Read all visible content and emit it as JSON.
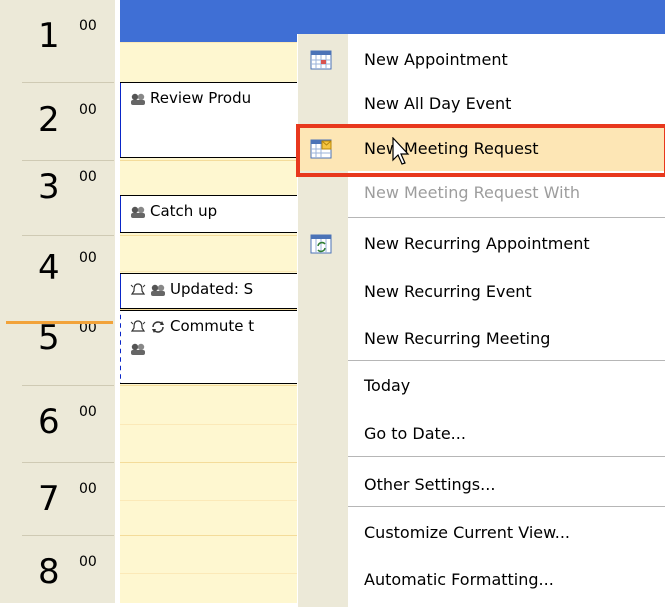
{
  "time_ruler": {
    "hours": [
      {
        "h": "1",
        "m": "00"
      },
      {
        "h": "2",
        "m": "00"
      },
      {
        "h": "3",
        "m": "00"
      },
      {
        "h": "4",
        "m": "00"
      },
      {
        "h": "5",
        "m": "00"
      },
      {
        "h": "6",
        "m": "00"
      },
      {
        "h": "7",
        "m": "00"
      },
      {
        "h": "8",
        "m": "00"
      }
    ],
    "current_hour": "5"
  },
  "appointments": [
    {
      "title": "Review Produ",
      "icons": "recurring-meeting-icon"
    },
    {
      "title": "Catch up",
      "icons": "meeting-icon"
    },
    {
      "title": "Updated: S",
      "icons": "reminder-meeting-icon"
    },
    {
      "title": "Commute t",
      "icons": "reminder-recurring-icon"
    }
  ],
  "context_menu": {
    "items": [
      {
        "label": "New Appointment",
        "icon": "calendar-grid-icon"
      },
      {
        "label": "New All Day Event",
        "icon": ""
      },
      {
        "label": "New Meeting Request",
        "icon": "meeting-request-icon",
        "highlighted": true
      },
      {
        "label": "New Meeting Request With",
        "icon": "",
        "disabled": true
      },
      {
        "label": "New Recurring Appointment",
        "icon": "recurring-calendar-icon"
      },
      {
        "label": "New Recurring Event",
        "icon": ""
      },
      {
        "label": "New Recurring Meeting",
        "icon": ""
      },
      {
        "label": "Today",
        "icon": ""
      },
      {
        "label": "Go to Date...",
        "icon": ""
      },
      {
        "label": "Other Settings...",
        "icon": ""
      },
      {
        "label": "Customize Current View...",
        "icon": ""
      },
      {
        "label": "Automatic Formatting...",
        "icon": ""
      }
    ]
  },
  "colors": {
    "header_blue": "#3f6fd5",
    "appointment_bar": "#0a26c8",
    "calendar_bg": "#fef7d0",
    "highlight_box": "#e8381d",
    "now_line": "#f2a33a"
  }
}
